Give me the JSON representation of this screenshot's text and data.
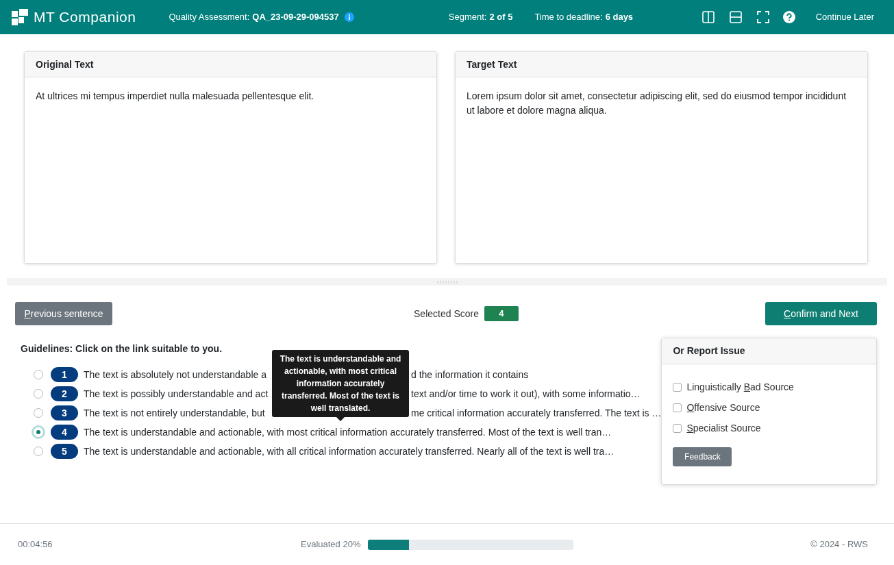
{
  "header": {
    "logo_text": "MT Companion",
    "assessment_label": "Quality Assessment:",
    "assessment_id": "QA_23-09-29-094537",
    "segment_label": "Segment:",
    "segment_value": "2 of 5",
    "deadline_label": "Time to deadline:",
    "deadline_value": "6 days",
    "continue_later": "Continue Later"
  },
  "panels": [
    {
      "title": "Original Text",
      "text": "At ultrices mi tempus imperdiet nulla malesuada pellentesque elit."
    },
    {
      "title": "Target Text",
      "text": "Lorem ipsum dolor sit amet, consectetur adipiscing elit, sed do eiusmod tempor incididunt ut labore et dolore magna aliqua."
    }
  ],
  "previous_button": {
    "label": [
      {
        "text": "P",
        "underline": true
      },
      {
        "text": "revious sentence",
        "underline": false
      }
    ]
  },
  "selected_score": {
    "label": "Selected Score",
    "value": "4"
  },
  "confirm_button": {
    "label": [
      {
        "text": "C",
        "underline": true
      },
      {
        "text": "onfirm and Next",
        "underline": false
      }
    ]
  },
  "guidelines": {
    "title": "Guidelines: Click on the link suitable to you.",
    "options": [
      {
        "score": "1",
        "selected": false,
        "text": "The text is absolutely not understandable a",
        "text_after": "d the information it contains"
      },
      {
        "score": "2",
        "selected": false,
        "text": "The text is possibly understandable and act",
        "text_after": "text and/or time to work it out), with some informatio…"
      },
      {
        "score": "3",
        "selected": false,
        "text": "The text is not entirely understandable, but",
        "text_after": "me critical information accurately transferred. The text is …"
      },
      {
        "score": "4",
        "selected": true,
        "text": "The text is understandable and actionable, with most critical information accurately transferred. Most of the text is well tran…"
      },
      {
        "score": "5",
        "selected": false,
        "text": "The text is understandable and actionable, with all critical information accurately transferred. Nearly all of the text is well tra…"
      }
    ],
    "tooltip": "The text is understandable and actionable, with most critical information accurately transferred. Most of the text is well translated."
  },
  "report": {
    "title": "Or Report Issue",
    "options": [
      {
        "label": [
          {
            "text": "Linguistically ",
            "underline": false
          },
          {
            "text": "B",
            "underline": true
          },
          {
            "text": "ad Source",
            "underline": false
          }
        ],
        "checked": false
      },
      {
        "label": [
          {
            "text": "O",
            "underline": true
          },
          {
            "text": "ffensive Source",
            "underline": false
          }
        ],
        "checked": false
      },
      {
        "label": [
          {
            "text": "S",
            "underline": true
          },
          {
            "text": "pecialist Source",
            "underline": false
          }
        ],
        "checked": false
      }
    ],
    "feedback_button": "Feedback"
  },
  "footer": {
    "timer": "00:04:56",
    "progress_label": "Evaluated 20%",
    "level": 0.2,
    "copyright": "© 2024 - RWS"
  }
}
